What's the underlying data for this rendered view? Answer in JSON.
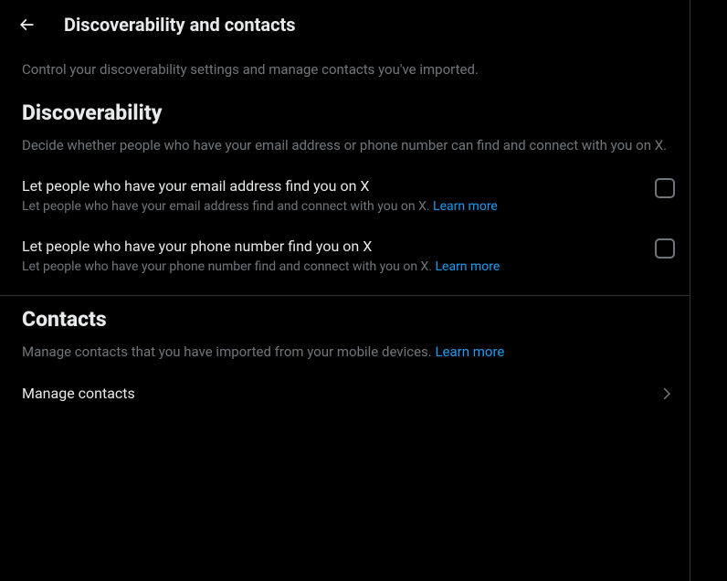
{
  "header": {
    "title": "Discoverability and contacts"
  },
  "page_description": "Control your discoverability settings and manage contacts you've imported.",
  "discoverability": {
    "title": "Discoverability",
    "description": "Decide whether people who have your email address or phone number can find and connect with you on X.",
    "email_setting": {
      "label": "Let people who have your email address find you on X",
      "sublabel": "Let people who have your email address find and connect with you on X. ",
      "learn_more": "Learn more",
      "checked": false
    },
    "phone_setting": {
      "label": "Let people who have your phone number find you on X",
      "sublabel": "Let people who have your phone number find and connect with you on X. ",
      "learn_more": "Learn more",
      "checked": false
    }
  },
  "contacts": {
    "title": "Contacts",
    "description": "Manage contacts that you have imported from your mobile devices. ",
    "learn_more": "Learn more",
    "manage_label": "Manage contacts"
  }
}
